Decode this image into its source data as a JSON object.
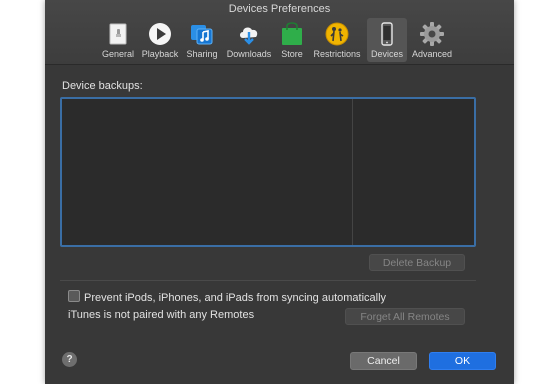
{
  "window": {
    "title": "Devices Preferences"
  },
  "toolbar": {
    "items": [
      {
        "label": "General",
        "icon": "general-icon"
      },
      {
        "label": "Playback",
        "icon": "play-icon"
      },
      {
        "label": "Sharing",
        "icon": "sharing-icon"
      },
      {
        "label": "Downloads",
        "icon": "download-cloud-icon"
      },
      {
        "label": "Store",
        "icon": "store-bag-icon"
      },
      {
        "label": "Restrictions",
        "icon": "restrictions-icon"
      },
      {
        "label": "Devices",
        "icon": "phone-icon",
        "selected": true
      },
      {
        "label": "Advanced",
        "icon": "gear-icon"
      }
    ]
  },
  "backups": {
    "label": "Device backups:",
    "delete_label": "Delete Backup"
  },
  "sync": {
    "prevent_label": "Prevent iPods, iPhones, and iPads from syncing automatically",
    "prevent_checked": false
  },
  "remotes": {
    "status": "iTunes is not paired with any Remotes",
    "forget_label": "Forget All Remotes"
  },
  "footer": {
    "help_label": "?",
    "cancel_label": "Cancel",
    "ok_label": "OK"
  },
  "colors": {
    "window_bg": "#383838",
    "accent": "#1f6fe0",
    "focus_ring": "#3a6ea5"
  }
}
